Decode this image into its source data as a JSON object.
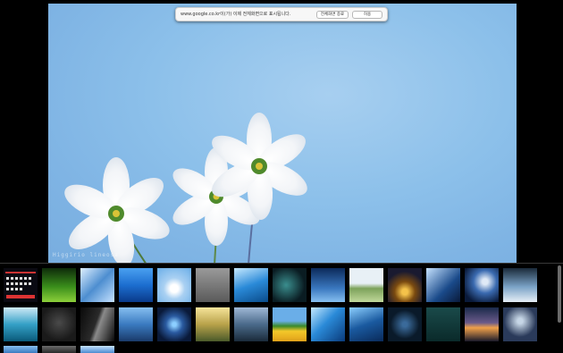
{
  "notification": {
    "message": "www.google.co.kr이(가) 이제 전체화면으로 표시됩니다.",
    "exit_label": "전체화면 종료",
    "hide_label": "허용"
  },
  "wallpaper": {
    "watermark": "Higgirio lineosa"
  },
  "tray": {
    "thumbnails": [
      {
        "name": "thumbnail-dark-grid"
      },
      {
        "name": "thumbnail-green-grass"
      },
      {
        "name": "thumbnail-blue-cubes"
      },
      {
        "name": "thumbnail-blue-ocean"
      },
      {
        "name": "thumbnail-white-bears"
      },
      {
        "name": "thumbnail-robot"
      },
      {
        "name": "thumbnail-sky-clouds"
      },
      {
        "name": "thumbnail-dark-cave"
      },
      {
        "name": "thumbnail-blue-skyline"
      },
      {
        "name": "thumbnail-road-field"
      },
      {
        "name": "thumbnail-tree-sunset"
      },
      {
        "name": "thumbnail-blue-leaves"
      },
      {
        "name": "thumbnail-galaxy-disk"
      },
      {
        "name": "thumbnail-lone-tree"
      },
      {
        "name": "thumbnail-turquoise-sea"
      },
      {
        "name": "thumbnail-dark-grey"
      },
      {
        "name": "thumbnail-dark-stripes"
      },
      {
        "name": "thumbnail-harbor-city"
      },
      {
        "name": "thumbnail-blue-light"
      },
      {
        "name": "thumbnail-golden-field"
      },
      {
        "name": "thumbnail-hills-sky"
      },
      {
        "name": "thumbnail-sunflowers"
      },
      {
        "name": "thumbnail-blue-wave"
      },
      {
        "name": "thumbnail-blue-abstract"
      },
      {
        "name": "thumbnail-night-swirl"
      },
      {
        "name": "thumbnail-teal-dark"
      },
      {
        "name": "thumbnail-city-night"
      },
      {
        "name": "thumbnail-frost-tree"
      },
      {
        "name": "thumbnail-blue-sky-small"
      },
      {
        "name": "thumbnail-grey-gradient"
      },
      {
        "name": "thumbnail-blue-water-small"
      }
    ]
  }
}
